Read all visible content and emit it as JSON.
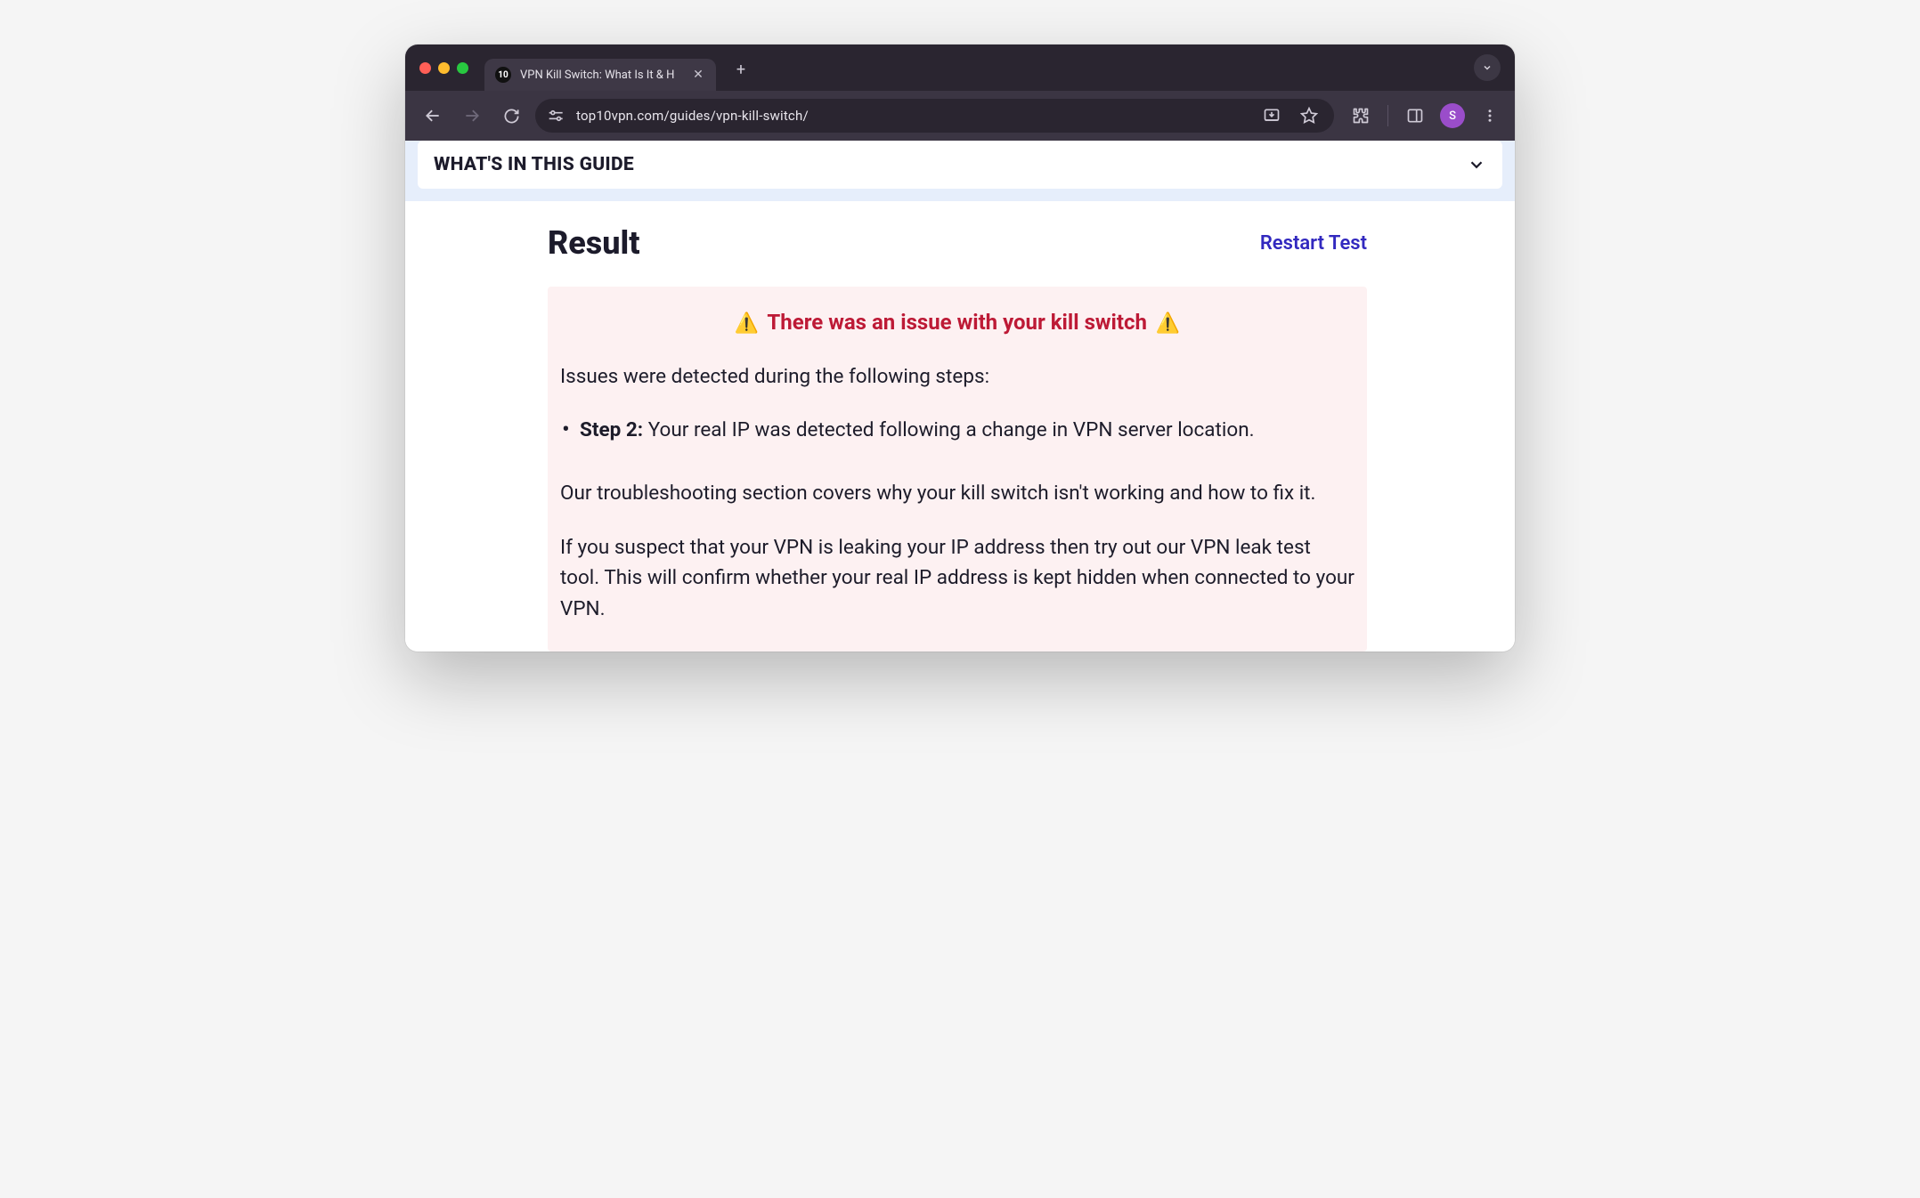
{
  "browser": {
    "tab_title": "VPN Kill Switch: What Is It & H",
    "favicon_text": "10",
    "url": "top10vpn.com/guides/vpn-kill-switch/",
    "profile_initial": "S"
  },
  "guide_bar": {
    "label": "WHAT'S IN THIS GUIDE"
  },
  "result": {
    "title": "Result",
    "restart_label": "Restart Test",
    "warning_heading": "There was an issue with your kill switch",
    "intro": "Issues were detected during the following steps:",
    "issues": [
      {
        "step": "Step 2:",
        "text": " Your real IP was detected following a change in VPN server location."
      }
    ],
    "troubleshoot": "Our troubleshooting section covers why your kill switch isn't working and how to fix it.",
    "leak_test": "If you suspect that your VPN is leaking your IP address then try out our VPN leak test tool. This will confirm whether your real IP address is kept hidden when connected to your VPN."
  }
}
